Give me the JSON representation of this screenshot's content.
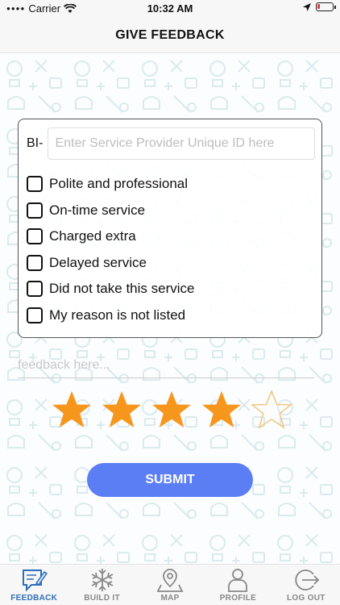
{
  "status_bar": {
    "carrier": "Carrier",
    "time": "10:32 AM",
    "battery_level_percent": 15
  },
  "header": {
    "title": "GIVE FEEDBACK"
  },
  "form": {
    "id_prefix": "BI-",
    "id_placeholder": "Enter Service Provider Unique ID here",
    "id_value": "",
    "options": [
      {
        "label": "Polite and professional",
        "checked": false
      },
      {
        "label": "On-time service",
        "checked": false
      },
      {
        "label": "Charged extra",
        "checked": false
      },
      {
        "label": "Delayed service",
        "checked": false
      },
      {
        "label": "Did not take this service",
        "checked": false
      },
      {
        "label": "My reason is not listed",
        "checked": false
      }
    ],
    "feedback_placeholder": "feedback here...",
    "rating": 4,
    "rating_max": 5,
    "submit_label": "SUBMIT"
  },
  "colors": {
    "star_filled": "#f7961d",
    "star_outline": "#f0c77d",
    "submit_bg": "#5b7ef5",
    "tab_active": "#2f6db8",
    "tab_inactive": "#888888",
    "pattern": "#9fc9d6"
  },
  "tab_bar": {
    "tabs": [
      {
        "label": "FEEDBACK",
        "icon": "feedback-icon",
        "active": true
      },
      {
        "label": "BUILD IT",
        "icon": "snowflake-icon",
        "active": false
      },
      {
        "label": "MAP",
        "icon": "map-pin-icon",
        "active": false
      },
      {
        "label": "PROFILE",
        "icon": "profile-icon",
        "active": false
      },
      {
        "label": "LOG OUT",
        "icon": "logout-icon",
        "active": false
      }
    ]
  }
}
